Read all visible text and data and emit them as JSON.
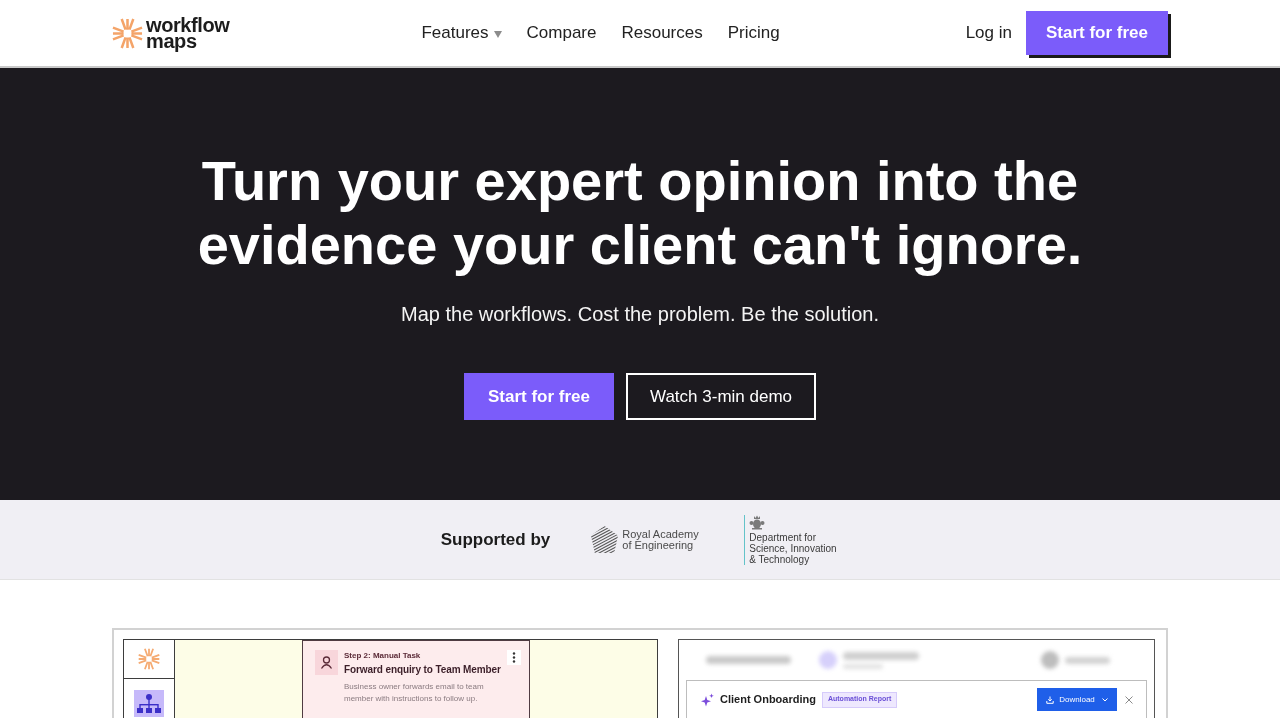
{
  "header": {
    "logo": {
      "line_1": "workflow",
      "line_2": "maps"
    },
    "nav": [
      {
        "label": "Features",
        "dropdown": true
      },
      {
        "label": "Compare",
        "dropdown": false
      },
      {
        "label": "Resources",
        "dropdown": false
      },
      {
        "label": "Pricing",
        "dropdown": false
      }
    ],
    "login": "Log in",
    "cta": "Start for free"
  },
  "hero": {
    "heading": "Turn your expert opinion into the evidence your client can't ignore.",
    "subtitle": "Map the workflows. Cost the problem. Be the solution.",
    "buttons": [
      {
        "label": "Start for free",
        "kind": "primary"
      },
      {
        "label": "Watch 3-min demo",
        "kind": "outline"
      }
    ]
  },
  "supporters": {
    "label": "Supported by",
    "logos": [
      {
        "kind": "academy",
        "name": "Royal Academy of Engineering"
      },
      {
        "kind": "department",
        "name": "Department for Science, Innovation & Technology"
      }
    ]
  },
  "preview": {
    "map_editor": {
      "step_card": {
        "step_label": "Step 2: Manual Task",
        "title": "Forward enquiry to Team Member",
        "description": "Business owner forwards email to team member with instructions to follow up."
      }
    },
    "report": {
      "title": "Client Onboarding",
      "badge": "Automation Report",
      "download_button": "Download"
    }
  }
}
